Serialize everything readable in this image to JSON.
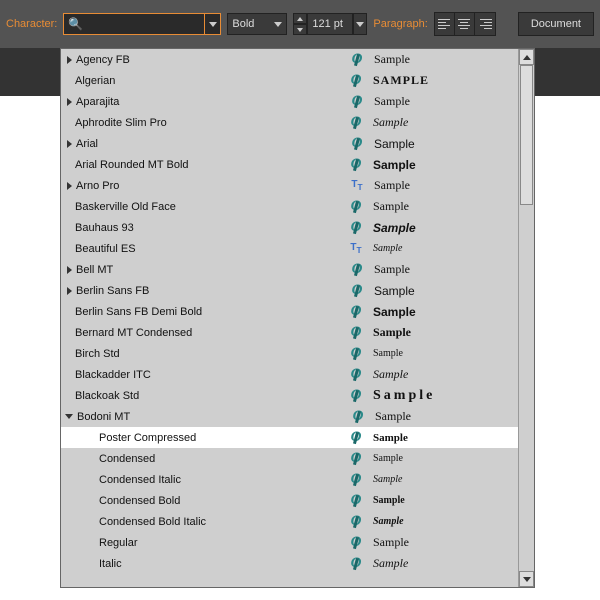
{
  "toolbar": {
    "character_label": "Character:",
    "font_search_placeholder": "",
    "style_value": "Bold",
    "size_value": "121 pt",
    "paragraph_label": "Paragraph:",
    "document_label": "Document"
  },
  "fonts": [
    {
      "name": "Agency FB",
      "arrow": "r",
      "type": "O",
      "sample": "Sample",
      "style": "font-family:Arial Narrow;"
    },
    {
      "name": "Algerian",
      "arrow": "",
      "type": "O",
      "sample": "SAMPLE",
      "style": "font-family:Georgia; font-weight:bold; letter-spacing:1px;"
    },
    {
      "name": "Aparajita",
      "arrow": "r",
      "type": "O",
      "sample": "Sample",
      "style": "font-family:Georgia;"
    },
    {
      "name": "Aphrodite Slim Pro",
      "arrow": "",
      "type": "O",
      "sample": "Sample",
      "style": "font-family:'Brush Script MT',cursive; font-style:italic;"
    },
    {
      "name": "Arial",
      "arrow": "r",
      "type": "O",
      "sample": "Sample",
      "style": "font-family:Arial;"
    },
    {
      "name": "Arial Rounded MT Bold",
      "arrow": "",
      "type": "O",
      "sample": "Sample",
      "style": "font-family:Arial; font-weight:bold;"
    },
    {
      "name": "Arno Pro",
      "arrow": "r",
      "type": "TT",
      "sample": "Sample",
      "style": "font-family:Georgia;"
    },
    {
      "name": "Baskerville Old Face",
      "arrow": "",
      "type": "O",
      "sample": "Sample",
      "style": "font-family:Baskerville,Georgia;"
    },
    {
      "name": "Bauhaus 93",
      "arrow": "",
      "type": "O",
      "sample": "Sample",
      "style": "font-family:Arial; font-weight:bold; font-style:italic;"
    },
    {
      "name": "Beautiful ES",
      "arrow": "",
      "type": "TT",
      "sample": "Sample",
      "style": "font-family:cursive; font-style:italic; font-size:10px;"
    },
    {
      "name": "Bell MT",
      "arrow": "r",
      "type": "O",
      "sample": "Sample",
      "style": "font-family:Georgia;"
    },
    {
      "name": "Berlin Sans FB",
      "arrow": "r",
      "type": "O",
      "sample": "Sample",
      "style": "font-family:Arial;"
    },
    {
      "name": "Berlin Sans FB Demi Bold",
      "arrow": "",
      "type": "O",
      "sample": "Sample",
      "style": "font-family:Arial; font-weight:bold;"
    },
    {
      "name": "Bernard MT Condensed",
      "arrow": "",
      "type": "O",
      "sample": "Sample",
      "style": "font-family:Georgia; font-weight:bold;"
    },
    {
      "name": "Birch Std",
      "arrow": "",
      "type": "O",
      "sample": "Sample",
      "style": "font-family:Georgia; font-size:10px;"
    },
    {
      "name": "Blackadder ITC",
      "arrow": "",
      "type": "O",
      "sample": "Sample",
      "style": "font-family:cursive; font-style:italic;"
    },
    {
      "name": "Blackoak Std",
      "arrow": "",
      "type": "O",
      "sample": "Sample",
      "style": "font-family:Georgia; font-weight:900; letter-spacing:3px; font-size:14px;"
    },
    {
      "name": "Bodoni MT",
      "arrow": "d",
      "type": "O",
      "sample": "Sample",
      "style": "font-family:Georgia;"
    }
  ],
  "subfonts": [
    {
      "name": "Poster Compressed",
      "type": "O",
      "sample": "Sample",
      "style": "font-family:Georgia; font-weight:bold; font-size:11px;",
      "hl": true
    },
    {
      "name": "Condensed",
      "type": "O",
      "sample": "Sample",
      "style": "font-family:Georgia; font-size:10px;"
    },
    {
      "name": "Condensed Italic",
      "type": "O",
      "sample": "Sample",
      "style": "font-family:Georgia; font-style:italic; font-size:10px;"
    },
    {
      "name": "Condensed Bold",
      "type": "O",
      "sample": "Sample",
      "style": "font-family:Georgia; font-weight:bold; font-size:10px;"
    },
    {
      "name": "Condensed Bold Italic",
      "type": "O",
      "sample": "Sample",
      "style": "font-family:Georgia; font-weight:bold; font-style:italic; font-size:10px;"
    },
    {
      "name": "Regular",
      "type": "O",
      "sample": "Sample",
      "style": "font-family:Georgia;"
    },
    {
      "name": "Italic",
      "type": "O",
      "sample": "Sample",
      "style": "font-family:Georgia; font-style:italic;"
    }
  ]
}
